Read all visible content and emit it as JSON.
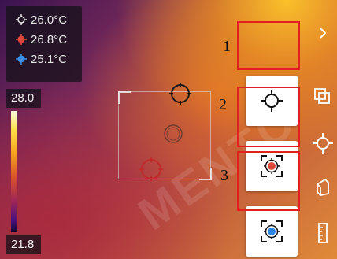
{
  "readouts": [
    {
      "value": "26.0°C",
      "icon": "max-crosshair-icon",
      "color": "#e8e8e8"
    },
    {
      "value": "26.8°C",
      "icon": "hot-spot-icon",
      "color": "#e0453a"
    },
    {
      "value": "25.1°C",
      "icon": "cold-spot-icon",
      "color": "#3a8fe8"
    }
  ],
  "scale": {
    "max": "28.0",
    "min": "21.8"
  },
  "callouts": [
    "1",
    "2",
    "3"
  ],
  "toolbar": {
    "expand_icon": "chevron-right-icon",
    "items": [
      "layers-icon",
      "crosshair-icon",
      "eraser-icon",
      "ruler-icon"
    ]
  },
  "cards": [
    {
      "icon": "center-point-icon"
    },
    {
      "icon": "hot-spot-target-icon",
      "accent": "#e0453a"
    },
    {
      "icon": "cold-spot-target-icon",
      "accent": "#2f86e8"
    }
  ],
  "highlight_color": "#e32020"
}
